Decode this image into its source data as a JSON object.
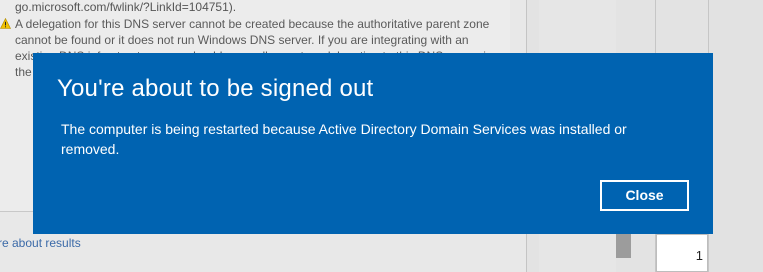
{
  "background": {
    "link_text": "go.microsoft.com/fwlink/?LinkId=104751).",
    "warning_text": "A delegation for this DNS server cannot be created because the authoritative parent zone cannot be found or it does not run Windows DNS server. If you are integrating with an existing DNS infrastructure, you should manually create a delegation to this DNS server in the parent zone to ensure reliable name resolution from outside the domain \"cyb",
    "results_link": "re about results",
    "page_number": "1"
  },
  "dialog": {
    "title": "You're about to be signed out",
    "message": "The computer is being restarted because Active Directory Domain Services was installed or removed.",
    "close_label": "Close"
  },
  "colors": {
    "dialog_background": "#0063b1",
    "dialog_text": "#ffffff",
    "warning_icon": "#f2c200",
    "link": "#3b6aa8"
  },
  "icons": {
    "warning": "warning-icon"
  }
}
